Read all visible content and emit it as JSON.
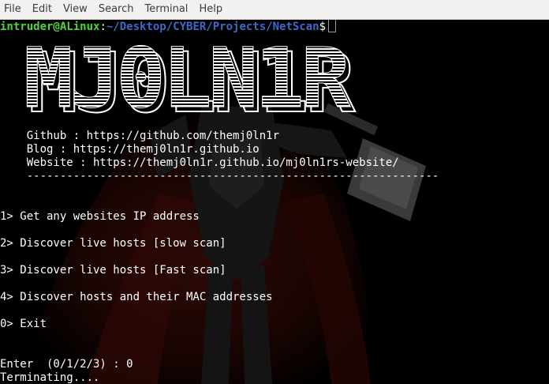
{
  "menubar": {
    "items": [
      "File",
      "Edit",
      "View",
      "Search",
      "Terminal",
      "Help"
    ]
  },
  "terminal": {
    "prompt": {
      "user_host": "intruder@ALinux",
      "separator": ":",
      "path": "~/Desktop/CYBER/Projects/NetScan",
      "symbol": "$"
    },
    "banner_text": "MJ0LN1R",
    "info": {
      "github": "    Github : https://github.com/themj0ln1r",
      "blog": "    Blog : https://themj0ln1r.github.io",
      "website": "    Website : https://themj0ln1r.github.io/mj0ln1rs-website/",
      "divider": "    --------------------------------------------------------------"
    },
    "options": [
      "1> Get any websites IP address",
      "2> Discover live hosts [slow scan]",
      "3> Discover live hosts [Fast scan]",
      "4> Discover hosts and their MAC addresses",
      "0> Exit"
    ],
    "input_line": "Enter  (0/1/2/3) : 0",
    "status_line": "Terminating...."
  },
  "colors": {
    "background": "#000000",
    "prompt_user": "#4fd33a",
    "prompt_path": "#3f68c8",
    "text": "#ffffff",
    "menubar_bg": "#f2f1f0",
    "wallpaper_tint": "#3a0c08"
  }
}
